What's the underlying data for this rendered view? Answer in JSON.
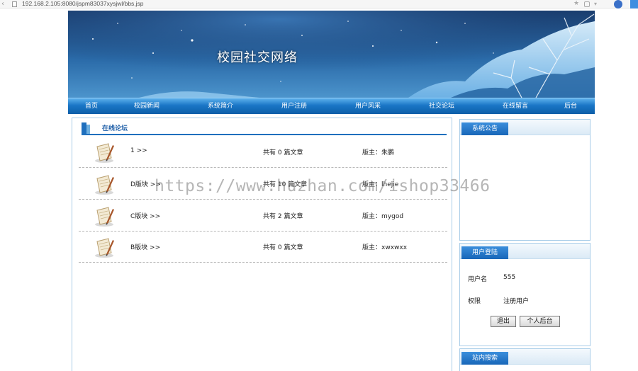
{
  "browser": {
    "url": "192.168.2.105:8080/jspm83037xysjwl/bbs.jsp"
  },
  "header": {
    "site_title": "校园社交网络"
  },
  "nav": {
    "items": [
      "首页",
      "校园新闻",
      "系统简介",
      "用户注册",
      "用户风采",
      "社交论坛",
      "在线留言",
      "后台"
    ]
  },
  "forum": {
    "title": "在线论坛",
    "boards": [
      {
        "name": "1 >>",
        "count_text": "共有 0 篇文章",
        "moderator_label": "版主：",
        "moderator": "朱鹏"
      },
      {
        "name": "D版块 >>",
        "count_text": "共有 10 篇文章",
        "moderator_label": "版主：",
        "moderator": "lhejie"
      },
      {
        "name": "C版块 >>",
        "count_text": "共有 2 篇文章",
        "moderator_label": "版主：",
        "moderator": "mygod"
      },
      {
        "name": "B版块 >>",
        "count_text": "共有 0 篇文章",
        "moderator_label": "版主：",
        "moderator": "xwxwxx"
      }
    ]
  },
  "sidebar": {
    "notice": {
      "title": "系统公告"
    },
    "login": {
      "title": "用户登陆",
      "username_label": "用户名",
      "username_value": "555",
      "role_label": "权限",
      "role_value": "注册用户",
      "logout_label": "退出",
      "personal_label": "个人后台"
    },
    "search": {
      "title": "站内搜索"
    }
  },
  "watermark": "https://www.huzhan.com/ishop33466",
  "colors": {
    "nav_blue": "#1a76c6",
    "accent_blue": "#1f6fbd",
    "panel_border": "#a9cde8"
  }
}
